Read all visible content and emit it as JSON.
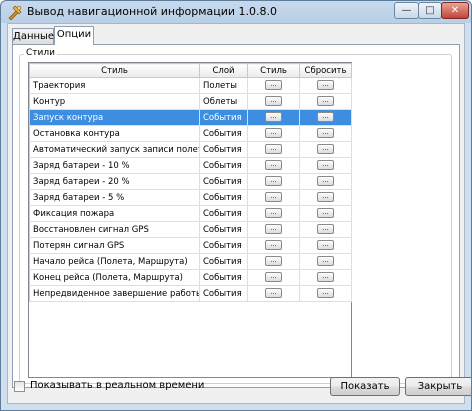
{
  "window": {
    "title": "Вывод навигационной информации 1.0.8.0",
    "minimize_glyph": "—",
    "maximize_glyph": "□",
    "close_glyph": "✕"
  },
  "tabs": [
    {
      "label": "Данные"
    },
    {
      "label": "Опции"
    }
  ],
  "group": {
    "legend": "Стили"
  },
  "grid": {
    "headers": [
      "Стиль",
      "Слой",
      "Стиль",
      "Сбросить"
    ],
    "button_glyph": "...",
    "rows": [
      {
        "name": "Траектория",
        "layer": "Полеты",
        "selected": false
      },
      {
        "name": "Контур",
        "layer": "Облеты",
        "selected": false
      },
      {
        "name": "Запуск контура",
        "layer": "События",
        "selected": true
      },
      {
        "name": "Остановка контура",
        "layer": "События",
        "selected": false
      },
      {
        "name": "Автоматический запуск записи полета",
        "layer": "События",
        "selected": false
      },
      {
        "name": "Заряд батареи - 10 %",
        "layer": "События",
        "selected": false
      },
      {
        "name": "Заряд батареи - 20 %",
        "layer": "События",
        "selected": false
      },
      {
        "name": "Заряд батареи - 5 %",
        "layer": "События",
        "selected": false
      },
      {
        "name": "Фиксация пожара",
        "layer": "События",
        "selected": false
      },
      {
        "name": "Восстановлен сигнал GPS",
        "layer": "События",
        "selected": false
      },
      {
        "name": "Потерян сигнал GPS",
        "layer": "События",
        "selected": false
      },
      {
        "name": "Начало рейса (Полета, Маршрута)",
        "layer": "События",
        "selected": false
      },
      {
        "name": "Конец рейса (Полета, Маршрута)",
        "layer": "События",
        "selected": false
      },
      {
        "name": "Непредвиденное завершение работы",
        "layer": "События",
        "selected": false
      }
    ]
  },
  "footer": {
    "realtime_label": "Показывать в реальном времени",
    "realtime_checked": false,
    "show_button": "Показать",
    "close_button": "Закрыть"
  },
  "colors": {
    "selection": "#3d8ee0",
    "close_button": "#c0453a"
  }
}
